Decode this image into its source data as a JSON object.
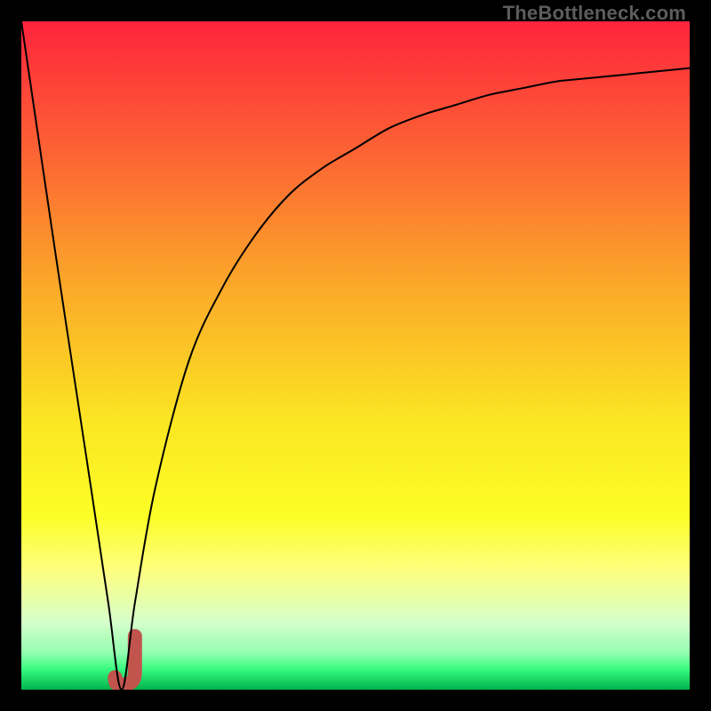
{
  "watermark": "TheBottleneck.com",
  "chart_data": {
    "type": "line",
    "title": "",
    "xlabel": "",
    "ylabel": "",
    "xlim": [
      0,
      100
    ],
    "ylim": [
      0,
      100
    ],
    "grid": false,
    "series": [
      {
        "name": "bottleneck-curve",
        "x": [
          0,
          5,
          10,
          13,
          15,
          17,
          20,
          25,
          30,
          35,
          40,
          45,
          50,
          55,
          60,
          65,
          70,
          75,
          80,
          85,
          90,
          95,
          100
        ],
        "y": [
          100,
          66,
          33,
          13,
          0,
          13,
          30,
          49,
          60,
          68,
          74,
          78,
          81,
          84,
          86,
          87.5,
          89,
          90,
          91,
          91.5,
          92,
          92.5,
          93
        ],
        "stroke": "#000000",
        "width": 2
      }
    ],
    "highlight": {
      "name": "optimal-region",
      "x_range": [
        14,
        17
      ],
      "y_range": [
        0,
        8
      ],
      "color": "#c1554e"
    },
    "background_gradient": {
      "stops": [
        {
          "offset": 0.0,
          "color": "#fe243d"
        },
        {
          "offset": 0.2,
          "color": "#fc6533"
        },
        {
          "offset": 0.4,
          "color": "#fbaa29"
        },
        {
          "offset": 0.6,
          "color": "#fbe622"
        },
        {
          "offset": 0.74,
          "color": "#fcfe26"
        },
        {
          "offset": 0.82,
          "color": "#feff7d"
        },
        {
          "offset": 0.9,
          "color": "#d5ffcb"
        },
        {
          "offset": 0.945,
          "color": "#93feb0"
        },
        {
          "offset": 0.97,
          "color": "#35fa7e"
        },
        {
          "offset": 1.0,
          "color": "#02b24c"
        }
      ]
    }
  }
}
